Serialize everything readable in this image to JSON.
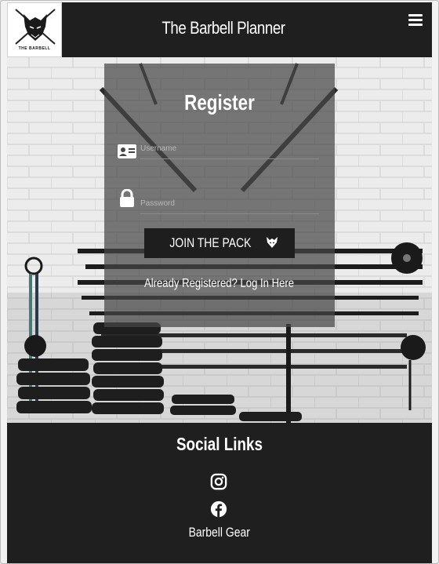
{
  "navbar": {
    "logo_text": "THE BARBELL",
    "brand": "The Barbell Planner",
    "menu_icon": "hamburger-menu-icon"
  },
  "register": {
    "title": "Register",
    "username_placeholder": "Username",
    "password_placeholder": "Password",
    "username_icon": "id-card-icon",
    "password_icon": "lock-icon",
    "join_label": "JOIN THE PACK",
    "join_icon": "wolf-icon",
    "login_link": "Already Registered? Log In Here"
  },
  "footer": {
    "title": "Social Links",
    "instagram_icon": "instagram-icon",
    "facebook_icon": "facebook-icon",
    "gear_link": "Barbell Gear"
  },
  "colors": {
    "dark": "#1f1f1f",
    "card": "#464646",
    "text": "#ffffff"
  }
}
